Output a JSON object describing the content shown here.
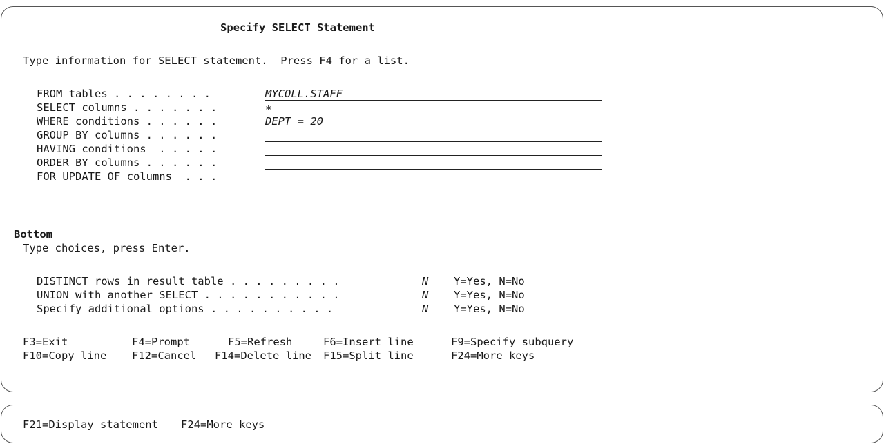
{
  "screen": {
    "title": "Specify SELECT Statement",
    "instruction": "Type information for SELECT statement.  Press F4 for a list."
  },
  "fields": [
    {
      "label": "FROM tables . . . . . . . .",
      "value": "MYCOLL.STAFF"
    },
    {
      "label": "SELECT columns . . . . . . .",
      "value": "*"
    },
    {
      "label": "WHERE conditions . . . . . .",
      "value": "DEPT = 20"
    },
    {
      "label": "GROUP BY columns . . . . . .",
      "value": ""
    },
    {
      "label": "HAVING conditions  . . . . .",
      "value": ""
    },
    {
      "label": "ORDER BY columns . . . . . .",
      "value": ""
    },
    {
      "label": "FOR UPDATE OF columns  . . .",
      "value": ""
    }
  ],
  "status": {
    "bottom": "Bottom",
    "choices_instruction": "Type choices, press Enter."
  },
  "options": [
    {
      "label": "DISTINCT rows in result table . . . . . . . . .",
      "value": "N",
      "hint": "Y=Yes, N=No"
    },
    {
      "label": "UNION with another SELECT . . . . . . . . . . .",
      "value": "N",
      "hint": "Y=Yes, N=No"
    },
    {
      "label": "Specify additional options . . . . . . . . . .",
      "value": "N",
      "hint": "Y=Yes, N=No"
    }
  ],
  "function_keys": {
    "row1": [
      "F3=Exit",
      "F4=Prompt",
      "F5=Refresh",
      "F6=Insert line",
      "F9=Specify subquery"
    ],
    "row2": [
      "F10=Copy line",
      "F12=Cancel",
      "F14=Delete line",
      "F15=Split line",
      "F24=More keys"
    ],
    "more": [
      "F21=Display statement",
      "F24=More keys"
    ]
  }
}
